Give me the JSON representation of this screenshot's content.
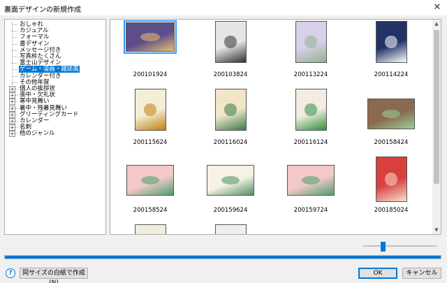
{
  "window": {
    "title": "裏面デザインの新規作成",
    "close_label": "✕"
  },
  "tree": {
    "items": [
      {
        "label": "おしゃれ",
        "expander": ""
      },
      {
        "label": "カジュアル",
        "expander": ""
      },
      {
        "label": "フォーマル",
        "expander": ""
      },
      {
        "label": "書デザイン",
        "expander": ""
      },
      {
        "label": "メッセージ付き",
        "expander": ""
      },
      {
        "label": "写真枠たくさん",
        "expander": ""
      },
      {
        "label": "富士山デザイン",
        "expander": ""
      },
      {
        "label": "ゲーム・漫画・雑誌風",
        "expander": "",
        "selected": true
      },
      {
        "label": "カレンダー付き",
        "expander": ""
      },
      {
        "label": "その他年賀",
        "expander": ""
      },
      {
        "label": "個人の挨拶状",
        "expander": "+"
      },
      {
        "label": "喪中・欠礼状",
        "expander": "+"
      },
      {
        "label": "寒中見舞い",
        "expander": "+"
      },
      {
        "label": "暑中・残暑見舞い",
        "expander": "+"
      },
      {
        "label": "グリーティングカード",
        "expander": "+"
      },
      {
        "label": "カレンダー",
        "expander": "+"
      },
      {
        "label": "名刺",
        "expander": "+"
      },
      {
        "label": "他のジャンル",
        "expander": "+"
      }
    ]
  },
  "templates": [
    {
      "code": "200101924",
      "color": "#5d4d8a",
      "accent": "#e8c070",
      "selected": true
    },
    {
      "code": "200103824",
      "color": "#e6e6e6",
      "accent": "#333333"
    },
    {
      "code": "200113224",
      "color": "#d8d0e8",
      "accent": "#8fb38f"
    },
    {
      "code": "200114224",
      "color": "#223366",
      "accent": "#ffffff"
    },
    {
      "code": "200115624",
      "color": "#f5eed6",
      "accent": "#c08010"
    },
    {
      "code": "200116024",
      "color": "#f2e6c8",
      "accent": "#3a7a4a"
    },
    {
      "code": "200116124",
      "color": "#f4ece0",
      "accent": "#2f8f3f"
    },
    {
      "code": "200158424",
      "color": "#8a6a50",
      "accent": "#9bcf9b"
    },
    {
      "code": "200158524",
      "color": "#f2c8c8",
      "accent": "#4aa06a"
    },
    {
      "code": "200159624",
      "color": "#f6f2e4",
      "accent": "#4f8f5f"
    },
    {
      "code": "200159724",
      "color": "#f2c8c8",
      "accent": "#4aa06a"
    },
    {
      "code": "200185024",
      "color": "#d84040",
      "accent": "#f6e0d0"
    },
    {
      "code": "",
      "color": "#f2ece0",
      "accent": "#c0a080"
    },
    {
      "code": "",
      "color": "#efefef",
      "accent": "#555555"
    }
  ],
  "zoom_slider": {
    "value": 0.25
  },
  "progress": {
    "value": 1.0
  },
  "buttons": {
    "help_label": "?",
    "blank_label": "同サイズの白紙で作成(N)",
    "ok_label": "OK",
    "cancel_label": "キャンセル"
  }
}
